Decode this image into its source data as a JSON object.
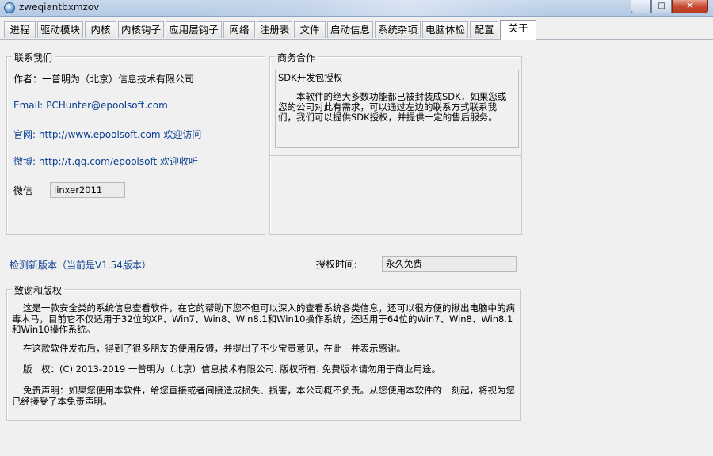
{
  "window": {
    "title": "zweqiantbxmzov",
    "min_glyph": "—",
    "max_glyph": "□",
    "close_glyph": "✕"
  },
  "tabs": [
    {
      "label": "进程",
      "active": false
    },
    {
      "label": "驱动模块",
      "active": false
    },
    {
      "label": "内核",
      "active": false
    },
    {
      "label": "内核钩子",
      "active": false
    },
    {
      "label": "应用层钩子",
      "active": false
    },
    {
      "label": "网络",
      "active": false
    },
    {
      "label": "注册表",
      "active": false
    },
    {
      "label": "文件",
      "active": false
    },
    {
      "label": "启动信息",
      "active": false
    },
    {
      "label": "系统杂项",
      "active": false
    },
    {
      "label": "电脑体检",
      "active": false
    },
    {
      "label": "配置",
      "active": false
    },
    {
      "label": "关于",
      "active": true
    }
  ],
  "contact": {
    "group_title": "联系我们",
    "author": "作者：一普明为（北京）信息技术有限公司",
    "email": "Email: PCHunter@epoolsoft.com",
    "website": "官网: http://www.epoolsoft.com 欢迎访问",
    "weibo": "微博: http://t.qq.com/epoolsoft 欢迎收听",
    "wechat_label": "微信",
    "wechat_value": "linxer2011"
  },
  "business": {
    "group_title": "商务合作",
    "sdk_title": "SDK开发包授权",
    "sdk_desc": "本软件的绝大多数功能都已被封装成SDK，如果您或您的公司对此有需求，可以通过左边的联系方式联系我们，我们可以提供SDK授权，并提供一定的售后服务。"
  },
  "update": {
    "check_link": "检测新版本（当前是V1.54版本）",
    "auth_label": "授权时间:",
    "auth_value": "永久免费"
  },
  "copyright": {
    "group_title": "致谢和版权",
    "p1": "这是一款安全类的系统信息查看软件，在它的帮助下您不但可以深入的查看系统各类信息，还可以很方便的揪出电脑中的病毒木马，目前它不仅适用于32位的XP、Win7、Win8、Win8.1和Win10操作系统，还适用于64位的Win7、Win8、Win8.1和Win10操作系统。",
    "p2": "在这款软件发布后，得到了很多朋友的使用反馈，并提出了不少宝贵意见，在此一并表示感谢。",
    "p3": "版　权：(C) 2013-2019 一普明为（北京）信息技术有限公司. 版权所有. 免费版本请勿用于商业用途。",
    "p4": "免责声明：如果您使用本软件，给您直接或者间接造成损失、损害，本公司概不负责。从您使用本软件的一刻起，将视为您已经接受了本免责声明。"
  }
}
